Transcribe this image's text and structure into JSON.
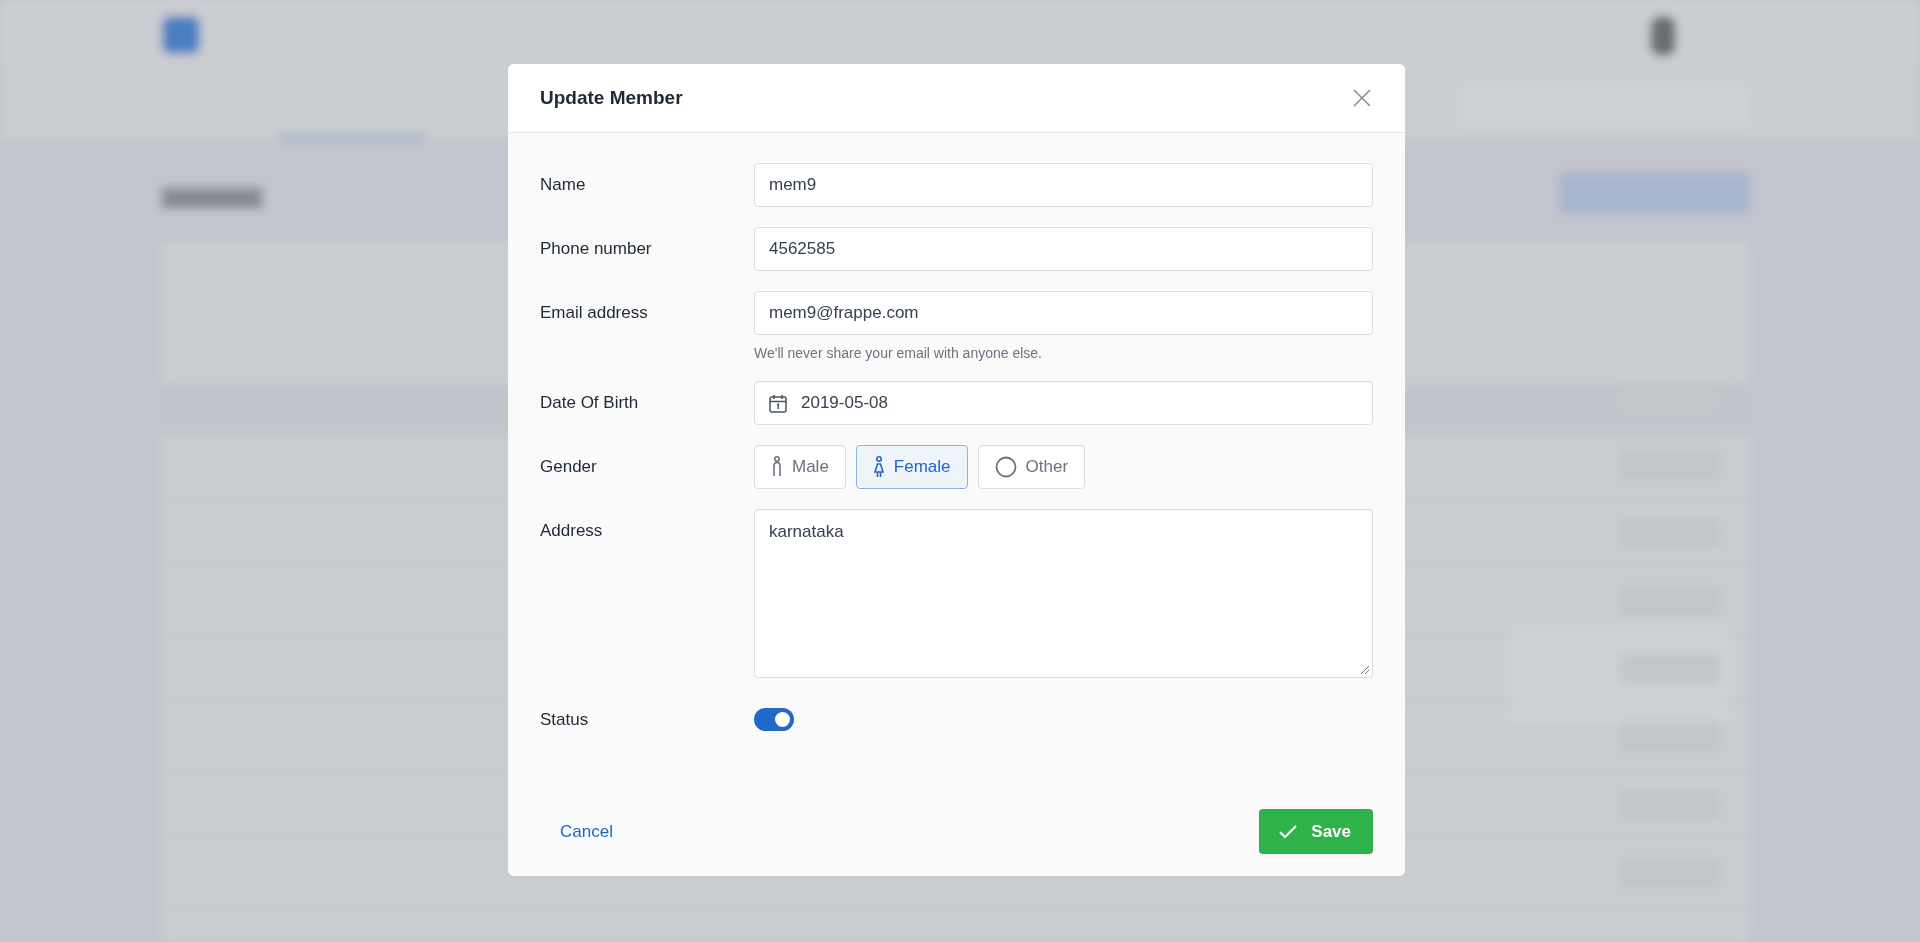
{
  "dialog": {
    "title": "Update Member",
    "fields": [
      {
        "kind": "text",
        "label": "Name",
        "value": "mem9"
      },
      {
        "kind": "text",
        "label": "Phone number",
        "value": "4562585"
      },
      {
        "kind": "text",
        "label": "Email address",
        "value": "mem9@frappe.com",
        "hint": "We'll never share your email with anyone else."
      },
      {
        "kind": "date",
        "label": "Date Of Birth",
        "value": "2019-05-08"
      },
      {
        "kind": "choice",
        "label": "Gender",
        "options": [
          {
            "label": "Male",
            "selected": false
          },
          {
            "label": "Female",
            "selected": true
          },
          {
            "label": "Other",
            "selected": false
          }
        ]
      },
      {
        "kind": "textarea",
        "label": "Address",
        "value": "karnataka"
      },
      {
        "kind": "toggle",
        "label": "Status",
        "on": true
      }
    ],
    "cancel": "Cancel",
    "save": "Save"
  }
}
